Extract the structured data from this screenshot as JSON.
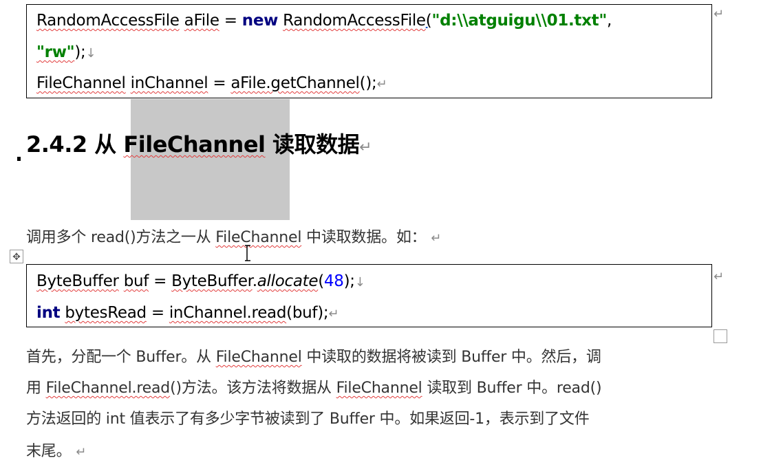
{
  "code_block_1": {
    "line1": {
      "type1": "RandomAccessFile",
      "var": "aFile",
      "eq": " = ",
      "kw_new": "new",
      "type2": "RandomAccessFile",
      "open_paren": "(",
      "path": "\"d:\\\\atguigu\\\\01.txt\"",
      "comma": ","
    },
    "line2": {
      "mode": "\"rw\"",
      "close": ");",
      "mark": "↓"
    },
    "line3": {
      "type": "FileChannel",
      "var": "inChannel",
      "eq": " = ",
      "call": "aFile.getChannel",
      "close": "();",
      "mark": "↵"
    },
    "right_mark": "↵"
  },
  "heading": {
    "prefix": "2.4.2 从 ",
    "class_name": "FileChannel",
    "suffix": " 读取数据",
    "mark": "↵"
  },
  "intro": {
    "before": "调用多个 read()方法之一从 ",
    "class_name": "FileChannel",
    "after": " 中读取数据。如：",
    "mark": "↵"
  },
  "code_block_2": {
    "line1": {
      "type1": "ByteBuffer",
      "var": "buf",
      "eq": " = ",
      "type2": "ByteBuffer",
      "dot": ".",
      "method": "allocate",
      "open": "(",
      "num": "48",
      "close": ");",
      "mark": "↓"
    },
    "line2": {
      "kw_int": "int",
      "var": "bytesRead",
      "eq": " = ",
      "call": "inChannel.read",
      "args": "(buf);",
      "mark": "↵"
    },
    "right_mark": "↵"
  },
  "body_para": {
    "l1_a": "首先，分配一个 Buffer。从 ",
    "l1_b": "FileChannel",
    "l1_c": " 中读取的数据将被读到 Buffer 中。然后，调",
    "l2_a": "用 ",
    "l2_b": "FileChannel.read",
    "l2_c": "()方法。该方法将数据从 ",
    "l2_d": "FileChannel",
    "l2_e": " 读取到 Buffer 中。read()",
    "l3": "方法返回的 int 值表示了有多少字节被读到了 Buffer 中。如果返回-1，表示到了文件",
    "l4": "末尾。",
    "mark": "↵"
  },
  "move_handle_glyph": "✥"
}
